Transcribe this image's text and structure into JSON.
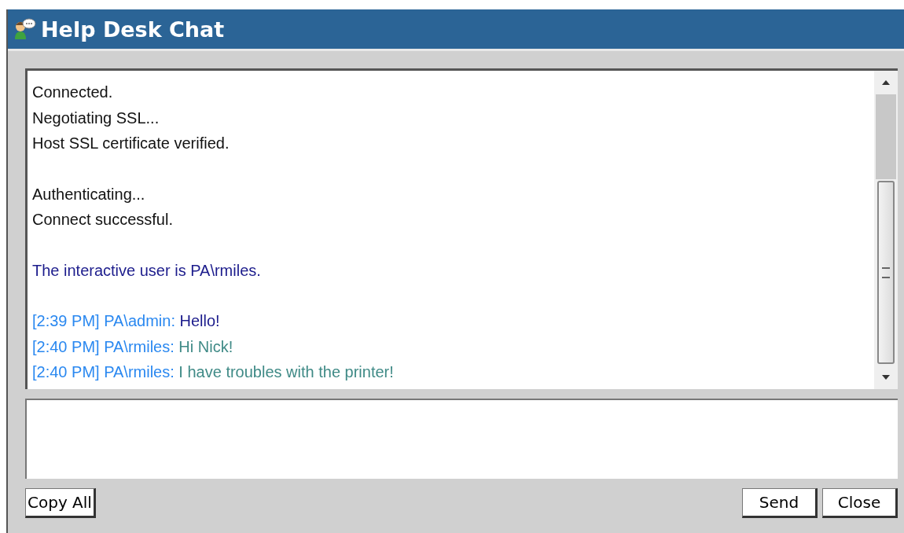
{
  "window": {
    "title": "Help Desk Chat"
  },
  "transcript": [
    {
      "lines": [
        {
          "kind": "status",
          "text": "Connected."
        },
        {
          "kind": "status",
          "text": "Negotiating SSL..."
        },
        {
          "kind": "status",
          "text": "Host SSL certificate verified."
        }
      ]
    },
    {
      "lines": [
        {
          "kind": "status",
          "text": "Authenticating..."
        },
        {
          "kind": "status",
          "text": "Connect successful."
        }
      ]
    },
    {
      "lines": [
        {
          "kind": "info",
          "text": "The interactive user is PA\\rmiles."
        }
      ]
    },
    {
      "lines": [
        {
          "kind": "chat",
          "prefix": "[2:39 PM] PA\\admin:",
          "text": "Hello!",
          "color": "#1c1c8c"
        },
        {
          "kind": "chat",
          "prefix": "[2:40 PM] PA\\rmiles:",
          "text": "Hi Nick!",
          "color": "#3f8a86"
        },
        {
          "kind": "chat",
          "prefix": "[2:40 PM] PA\\rmiles:",
          "text": "I have troubles with the printer!",
          "color": "#3f8a86"
        }
      ]
    }
  ],
  "buttons": [
    {
      "kind": "left",
      "label": "Copy All"
    },
    {
      "kind": "right",
      "label": "Send"
    },
    {
      "kind": "right",
      "label": "Close"
    }
  ]
}
